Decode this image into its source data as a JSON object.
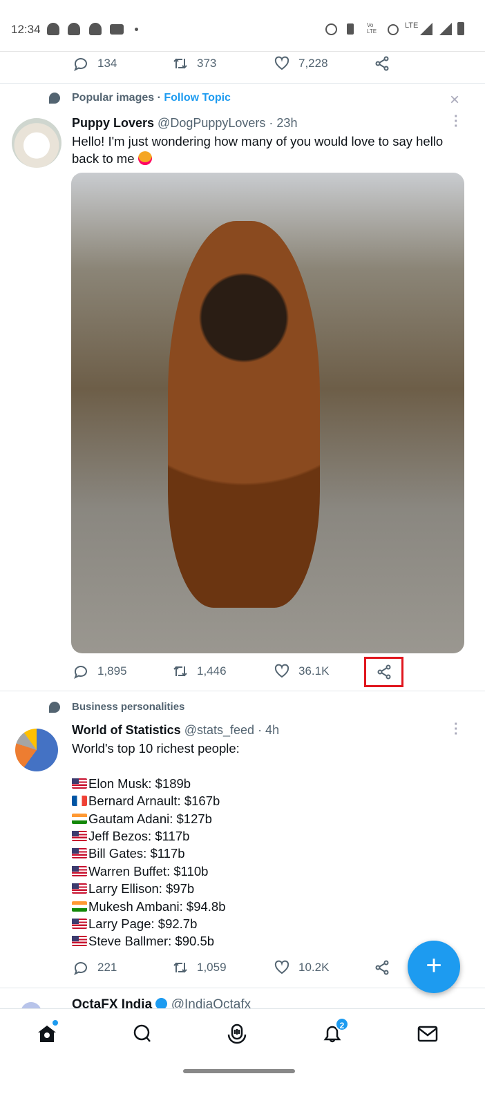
{
  "status_bar": {
    "time": "12:34",
    "network": "LTE"
  },
  "prev_tweet": {
    "replies": "134",
    "retweets": "373",
    "likes": "7,228"
  },
  "tweet1": {
    "topic": "Popular images",
    "separator": " · ",
    "follow": "Follow Topic",
    "name": "Puppy Lovers",
    "handle": "@DogPuppyLovers",
    "time": "· 23h",
    "text": "Hello! I'm just wondering how many of you would love to say hello back to me",
    "emoji": "🥰",
    "replies": "1,895",
    "retweets": "1,446",
    "likes": "36.1K",
    "share_highlight_color": "#e0161e"
  },
  "tweet2": {
    "topic": "Business personalities",
    "name": "World of Statistics",
    "handle": "@stats_feed",
    "time": "· 4h",
    "intro": "World's top 10 richest people:",
    "list": [
      {
        "flag": "us",
        "text": "Elon Musk: $189b"
      },
      {
        "flag": "fr",
        "text": "Bernard Arnault: $167b"
      },
      {
        "flag": "in",
        "text": "Gautam Adani: $127b"
      },
      {
        "flag": "us",
        "text": "Jeff Bezos: $117b"
      },
      {
        "flag": "us",
        "text": "Bill Gates: $117b"
      },
      {
        "flag": "us",
        "text": "Warren Buffet: $110b"
      },
      {
        "flag": "us",
        "text": "Larry Ellison: $97b"
      },
      {
        "flag": "in",
        "text": "Mukesh Ambani: $94.8b"
      },
      {
        "flag": "us",
        "text": "Larry Page: $92.7b"
      },
      {
        "flag": "us",
        "text": "Steve Ballmer: $90.5b"
      }
    ],
    "replies": "221",
    "retweets": "1,059",
    "likes": "10.2K"
  },
  "tweet3": {
    "name": "OctaFX India",
    "handle": "@IndiaOctafx"
  },
  "nav": {
    "notifications_badge": "2",
    "accent": "#1d9bf0"
  }
}
